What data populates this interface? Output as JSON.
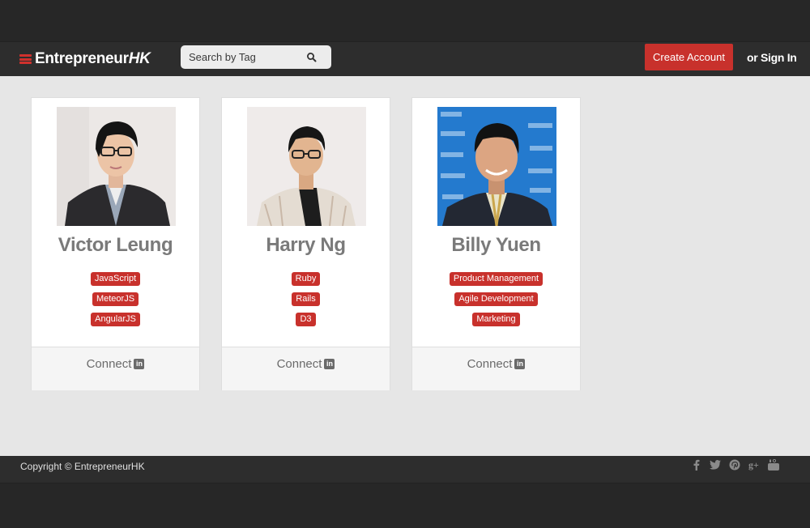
{
  "header": {
    "brand": {
      "plain": "Entrepreneur",
      "italic": "HK"
    },
    "search": {
      "placeholder": "Search by Tag"
    },
    "create_account": "Create Account",
    "sign_in": "or Sign In"
  },
  "profiles": [
    {
      "name": "Victor Leung",
      "tags": [
        "JavaScript",
        "MeteorJS",
        "AngularJS"
      ],
      "connect": "Connect"
    },
    {
      "name": "Harry Ng",
      "tags": [
        "Ruby",
        "Rails",
        "D3"
      ],
      "connect": "Connect"
    },
    {
      "name": "Billy Yuen",
      "tags": [
        "Product Management",
        "Agile Development",
        "Marketing"
      ],
      "connect": "Connect"
    }
  ],
  "footer": {
    "copyright": "Copyright © EntrepreneurHK",
    "social": [
      "facebook-icon",
      "twitter-icon",
      "pinterest-icon",
      "google-plus-icon",
      "youtube-icon"
    ]
  },
  "colors": {
    "accent": "#c8312c",
    "nav": "#2d2d2d",
    "background": "#e6e6e6"
  }
}
